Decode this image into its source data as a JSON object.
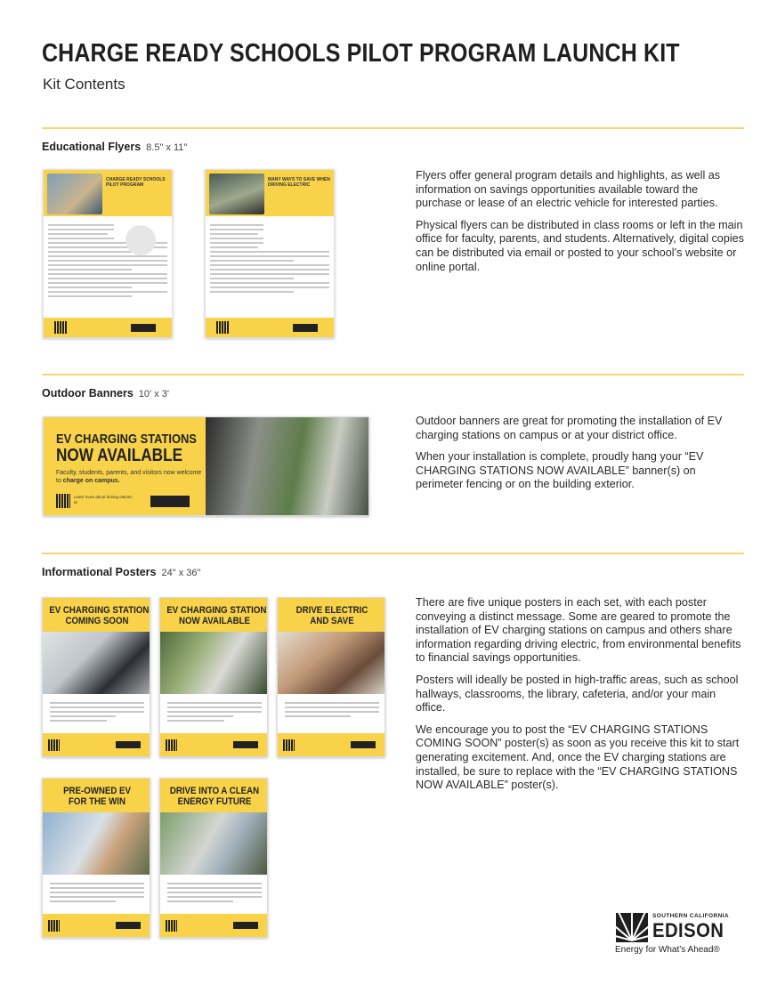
{
  "header": {
    "title": "CHARGE READY SCHOOLS PILOT PROGRAM LAUNCH KIT",
    "subtitle": "Kit Contents"
  },
  "sections": {
    "flyers": {
      "heading": "Educational Flyers",
      "size": "8.5\" x 11\"",
      "para1": "Flyers offer general program details and highlights, as well as information on savings opportunities available toward the purchase or lease of an electric vehicle for interested parties.",
      "para2": "Physical flyers can be distributed in class rooms or left in the main office for faculty, parents, and students. Alternatively, digital copies can be distributed via email or posted to your school’s website or online portal.",
      "thumb1_title": "CHARGE READY SCHOOLS PILOT PROGRAM",
      "thumb2_title": "MANY WAYS TO SAVE WHEN DRIVING ELECTRIC"
    },
    "banners": {
      "heading": "Outdoor Banners",
      "size": "10' x 3'",
      "para1": "Outdoor banners are great for promoting the installation of EV charging stations on campus or at your district office.",
      "para2": "When your installation is complete, proudly hang your “EV CHARGING STATIONS NOW AVAILABLE” banner(s) on perimeter fencing or on the building exterior.",
      "banner_line1": "EV CHARGING STATIONS",
      "banner_line2": "NOW AVAILABLE",
      "banner_sub_a": "Faculty, students, parents, and visitors now welcome to ",
      "banner_sub_b": "charge on campus.",
      "banner_learn": "Learn more about driving electric at"
    },
    "posters": {
      "heading": "Informational Posters",
      "size": "24\" x 36\"",
      "para1": "There are five unique posters in each set, with each poster conveying a distinct message. Some are geared to promote the installation of EV charging stations on campus and others share information regarding driving electric, from environmental benefits to financial savings opportunities.",
      "para2": "Posters will ideally be posted in high-traffic areas, such as school hallways, classrooms, the library, cafeteria, and/or your main office.",
      "para3": "We encourage you to post the “EV CHARGING STATIONS COMING SOON” poster(s) as soon as you receive this kit to start generating excitement. And, once the EV charging stations are installed, be sure to replace with the “EV CHARGING STATIONS NOW AVAILABLE” poster(s).",
      "items": [
        {
          "line1": "EV CHARGING STATIONS",
          "line2": "COMING SOON"
        },
        {
          "line1": "EV CHARGING STATIONS",
          "line2": "NOW AVAILABLE"
        },
        {
          "line1": "DRIVE ELECTRIC",
          "line2": "AND SAVE"
        },
        {
          "line1": "PRE-OWNED EV",
          "line2": "FOR THE WIN"
        },
        {
          "line1": "DRIVE INTO A CLEAN",
          "line2": "ENERGY FUTURE"
        }
      ]
    }
  },
  "logo": {
    "small": "SOUTHERN CALIFORNIA",
    "big": "EDISON",
    "tagline": "Energy for What’s Ahead®"
  },
  "colors": {
    "accent_yellow": "#f8d34a",
    "rule_yellow": "#f4d96a",
    "text_dark": "#1f1f1f"
  }
}
